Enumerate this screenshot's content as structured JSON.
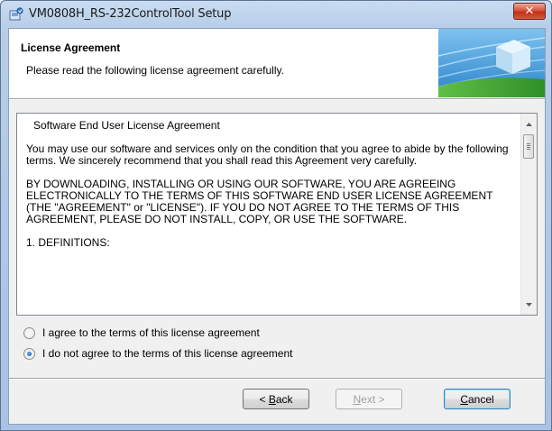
{
  "window": {
    "title": "VM0808H_RS-232ControlTool Setup",
    "close_glyph": "✕"
  },
  "header": {
    "title": "License Agreement",
    "subtitle": "Please read the following license agreement carefully."
  },
  "license": {
    "heading": "Software End User License Agreement",
    "para1": "You may use our software and services only on the condition that you agree to abide by the following terms. We sincerely recommend that you shall read this Agreement very carefully.",
    "para2": "BY DOWNLOADING, INSTALLING OR USING OUR SOFTWARE, YOU ARE AGREEING ELECTRONICALLY TO THE TERMS OF THIS SOFTWARE END USER LICENSE AGREEMENT (THE \"AGREEMENT\" or \"LICENSE\"). IF YOU DO NOT AGREE TO THE TERMS OF THIS AGREEMENT, PLEASE DO NOT INSTALL, COPY, OR USE THE SOFTWARE.",
    "para3": "1. DEFINITIONS:"
  },
  "options": {
    "agree_label": "I agree to the terms of this license agreement",
    "disagree_label": "I do not agree to the terms of this license agreement",
    "selected": "disagree"
  },
  "buttons": {
    "back_prefix": "< ",
    "back_accel": "B",
    "back_rest": "ack",
    "next_accel": "N",
    "next_rest": "ext >",
    "cancel_accel": "C",
    "cancel_rest": "ancel"
  },
  "colors": {
    "close_red": "#c33116",
    "radio_dot": "#0e4e9a"
  }
}
